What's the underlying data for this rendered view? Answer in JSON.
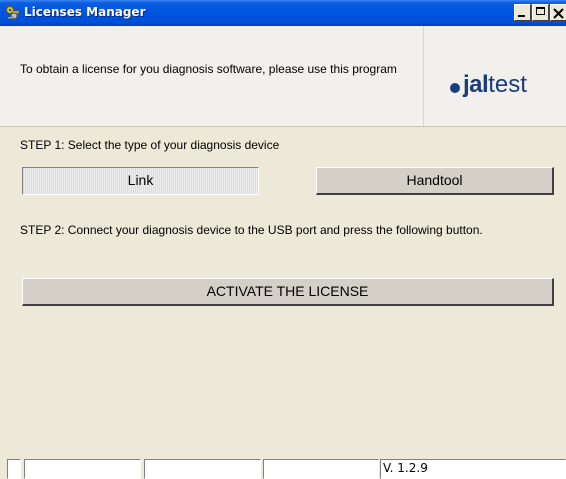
{
  "window": {
    "title": "Licenses Manager",
    "icon": "keys-icon",
    "controls": {
      "minimize": "minimize-icon",
      "maximize": "maximize-icon",
      "close": "close-icon"
    }
  },
  "header": {
    "description": "To obtain a license for you diagnosis software, please use this program",
    "logo": {
      "bold": "jal",
      "light": "test"
    }
  },
  "step1": {
    "label": "STEP 1: Select the type of your diagnosis device",
    "options": [
      {
        "label": "Link",
        "selected": true
      },
      {
        "label": "Handtool",
        "selected": false
      }
    ]
  },
  "step2": {
    "label": "STEP 2: Connect your diagnosis device to the USB port and press the following button.",
    "button": "ACTIVATE THE LICENSE"
  },
  "statusbar": {
    "version": "V. 1.2.9"
  },
  "colors": {
    "titlebar": "#0053e1",
    "window_bg": "#ece9d8",
    "header_bg": "#f1f0ec",
    "logo": "#1a3b7c"
  }
}
